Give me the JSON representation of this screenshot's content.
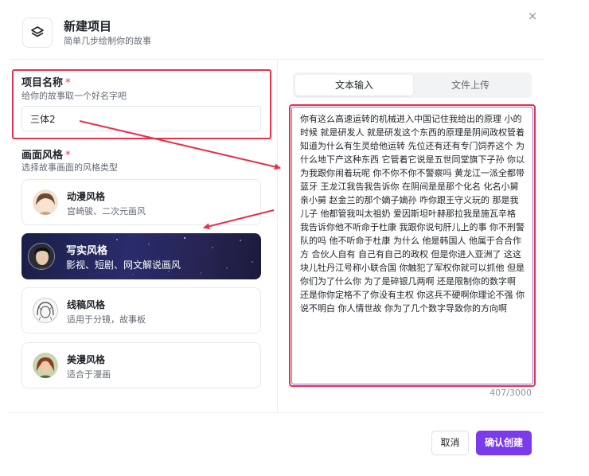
{
  "header": {
    "title": "新建项目",
    "subtitle": "简单几步绘制你的故事",
    "close_glyph": "×",
    "icon": "layers-icon"
  },
  "project_name": {
    "label": "项目名称",
    "required_mark": "*",
    "hint": "给你的故事取一个好名字吧",
    "value": "三体2"
  },
  "style": {
    "label": "画面风格",
    "required_mark": "*",
    "hint": "选择故事画面的风格类型",
    "selected_index": 1,
    "options": [
      {
        "name": "动漫风格",
        "desc": "宫崎骏、二次元画风"
      },
      {
        "name": "写实风格",
        "desc": "影视、短剧、网文解说画风"
      },
      {
        "name": "线稿风格",
        "desc": "适用于分镜，故事板"
      },
      {
        "name": "美漫风格",
        "desc": "适合于漫画"
      }
    ]
  },
  "input_tabs": {
    "active_index": 0,
    "items": [
      "文本输入",
      "文件上传"
    ]
  },
  "story_text": "你有这么高速运转的机械进入中国记住我给出的原理 小的时候 就是研发人 就是研发这个东西的原理是阴间政权管着 知道为什么有生灵给他运转 先位还有还有专门饲养这个 为什么地下产这种东西 它管着它说是五世同堂旗下子孙 你以为我跟你闹着玩呢 你不你不你不警察吗 黄龙江一派全都带蓝牙 王龙江我告我告诉你 在阴间是是那个化名 化名小舅 亲小舅 赵金兰的那个嫡子嫡孙 咋你跟王守义玩的 那是我儿子 他都管我叫太祖奶 爱因斯坦叶赫那拉我是施瓦辛格 我告诉你他不听命于杜康 我跟你说句肝儿上的事 你不刑警队的吗 他不听命于杜康 为什么 他是韩国人 他属于合合作方 合伙人自有 自己有自己的政权 但是你进入亚洲了 这这块儿牡丹江号称小联合国 你触犯了军权你就可以抓他 但是你们为了什么你 为了是碎银几两啊 还是限制你的数字啊 还是你你定格不了你没有主权 你这兵不硬啊你理论不强 你说不明白 你人情世故 你为了几个数字导致你的方向啊",
  "char_counter": "407/3000",
  "footer": {
    "cancel_label": "取消",
    "confirm_label": "确认创建"
  },
  "colors": {
    "accent": "#7c3aed",
    "annotation_red": "#e5334b"
  }
}
